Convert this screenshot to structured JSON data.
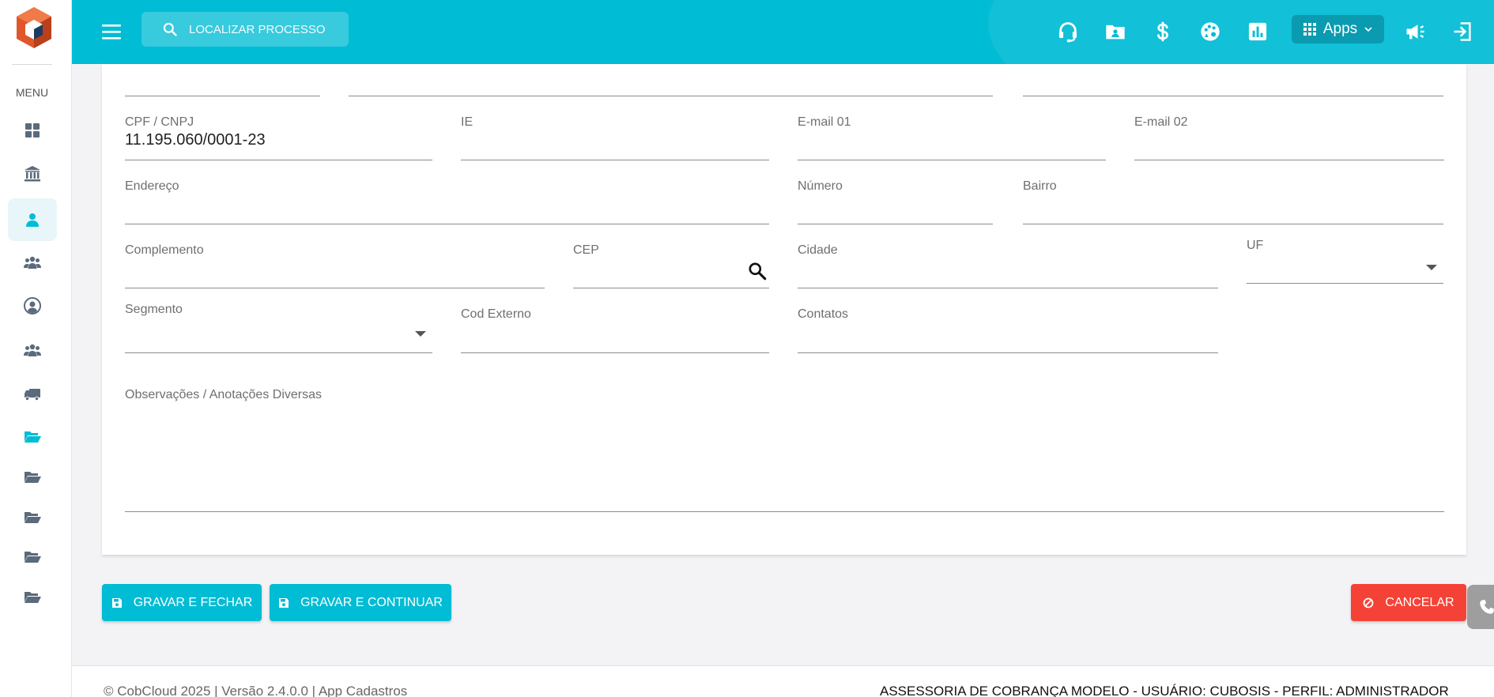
{
  "sidebar": {
    "menu_label": "MENU",
    "items": [
      {
        "icon": "dashboard-icon"
      },
      {
        "icon": "bank-icon"
      },
      {
        "icon": "user-icon",
        "active": true
      },
      {
        "icon": "users-group-icon"
      },
      {
        "icon": "user-circle-icon"
      },
      {
        "icon": "users-group-icon"
      },
      {
        "icon": "truck-icon"
      },
      {
        "icon": "folder-open-icon",
        "highlight": true
      },
      {
        "icon": "folder-open-icon"
      },
      {
        "icon": "folder-open-icon"
      },
      {
        "icon": "folder-open-icon"
      },
      {
        "icon": "folder-open-icon"
      }
    ]
  },
  "header": {
    "search_placeholder": "LOCALIZAR PROCESSO",
    "apps_label": "Apps",
    "icons": [
      "headset-icon",
      "folder-user-icon",
      "dollar-icon",
      "palette-icon",
      "chart-icon",
      "apps-grid-icon",
      "megaphone-icon",
      "logout-icon"
    ]
  },
  "form": {
    "cpf_cnpj": {
      "label": "CPF / CNPJ",
      "value": "11.195.060/0001-23"
    },
    "ie": {
      "label": "IE",
      "value": ""
    },
    "email1": {
      "label": "E-mail 01",
      "value": ""
    },
    "email2": {
      "label": "E-mail 02",
      "value": ""
    },
    "endereco": {
      "label": "Endereço",
      "value": ""
    },
    "numero": {
      "label": "Número",
      "value": ""
    },
    "bairro": {
      "label": "Bairro",
      "value": ""
    },
    "complemento": {
      "label": "Complemento",
      "value": ""
    },
    "cep": {
      "label": "CEP",
      "value": ""
    },
    "cidade": {
      "label": "Cidade",
      "value": ""
    },
    "uf": {
      "label": "UF",
      "value": ""
    },
    "segmento": {
      "label": "Segmento",
      "value": ""
    },
    "cod_externo": {
      "label": "Cod Externo",
      "value": ""
    },
    "contatos": {
      "label": "Contatos",
      "value": ""
    },
    "observacoes": {
      "label": "Observações / Anotações Diversas",
      "value": ""
    }
  },
  "actions": {
    "save_close": "GRAVAR E FECHAR",
    "save_continue": "GRAVAR E CONTINUAR",
    "cancel": "CANCELAR"
  },
  "footer": {
    "left": "© CobCloud 2025 | Versão 2.4.0.0 | App Cadastros",
    "right": "ASSESSORIA DE COBRANÇA MODELO - USUÁRIO: CUBOSIS - PERFIL: ADMINISTRADOR"
  },
  "colors": {
    "primary": "#00bcd4",
    "danger": "#f44336",
    "sidebar_icon": "#5b6a7c",
    "sidebar_active": "#00bcd4"
  }
}
